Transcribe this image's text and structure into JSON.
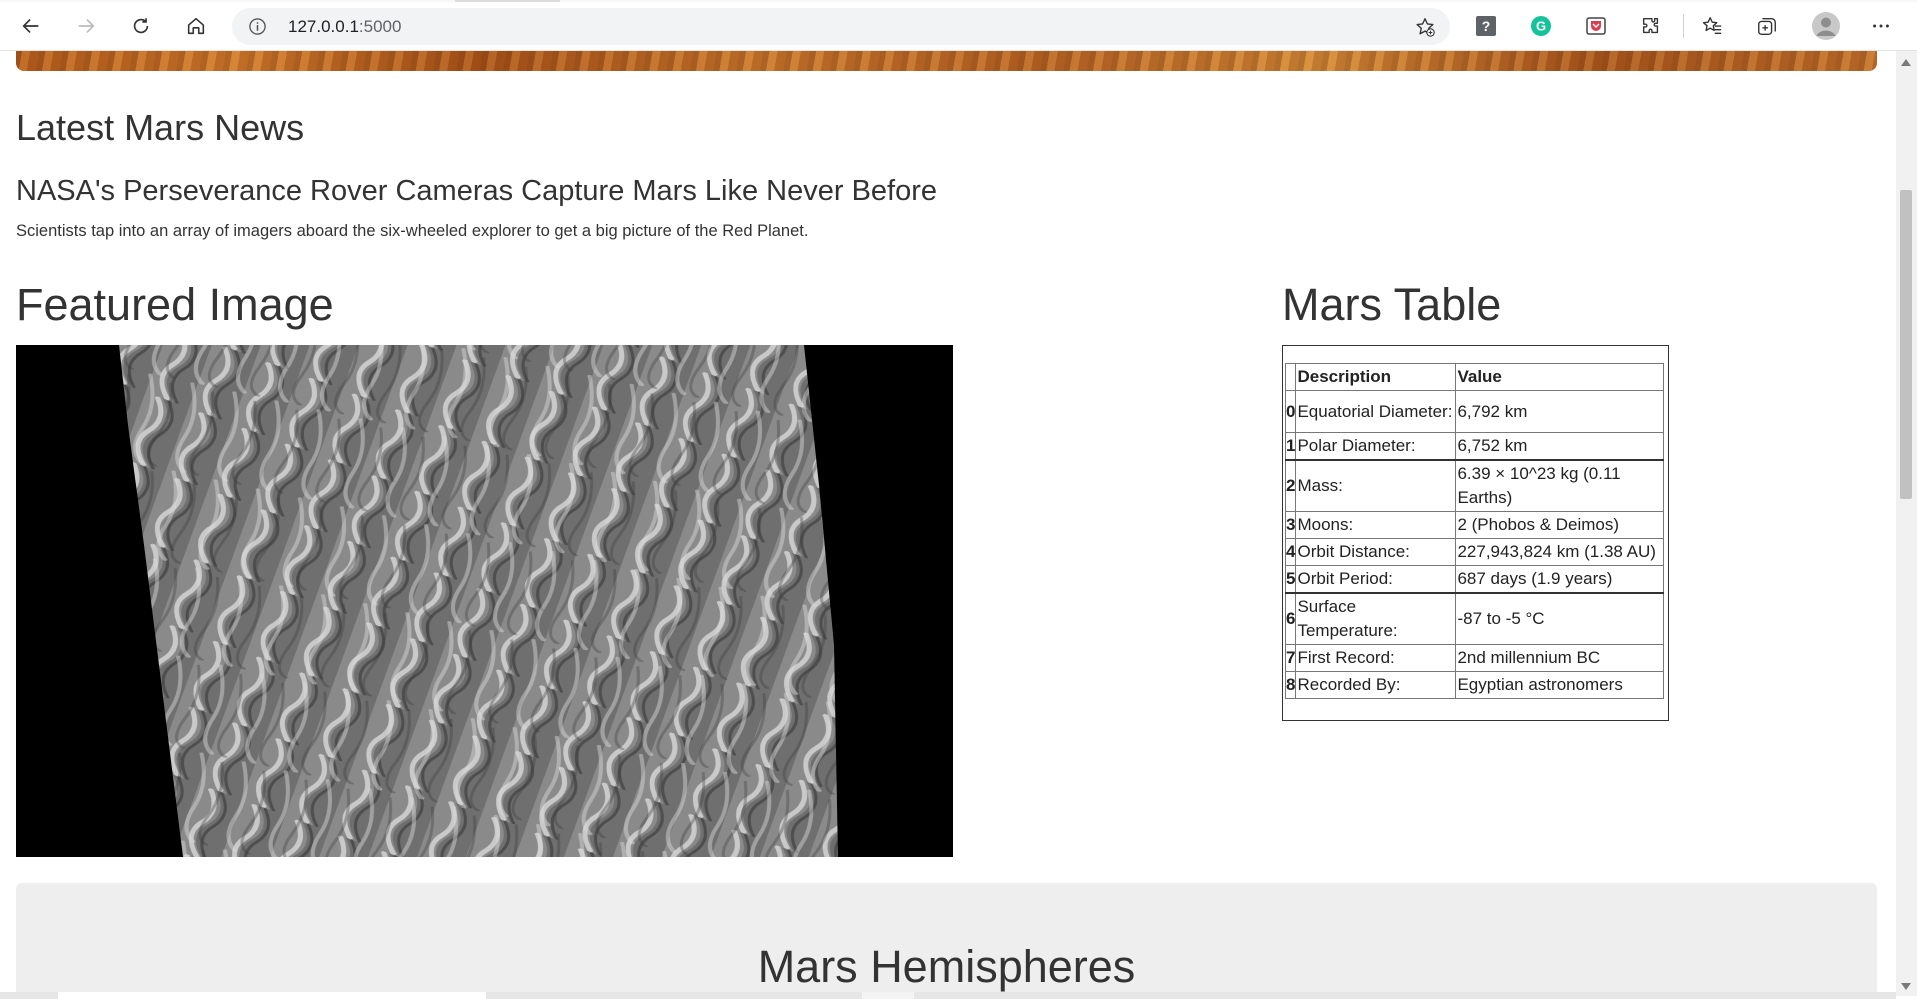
{
  "browser": {
    "url_host": "127.0.0.1",
    "url_port": ":5000",
    "icons": [
      "back-icon",
      "forward-icon",
      "refresh-icon",
      "home-icon",
      "site-info-icon",
      "add-favorite-icon",
      "help-extension-icon",
      "grammarly-icon",
      "pocket-icon",
      "extensions-icon",
      "favorites-icon",
      "collections-icon",
      "profile-icon",
      "more-icon"
    ]
  },
  "news": {
    "heading": "Latest Mars News",
    "title": "NASA's Perseverance Rover Cameras Capture Mars Like Never Before",
    "paragraph": "Scientists tap into an array of imagers aboard the six-wheeled explorer to get a big picture of the Red Planet."
  },
  "featured": {
    "heading": "Featured Image"
  },
  "mars_table": {
    "heading": "Mars Table",
    "columns": [
      "Description",
      "Value"
    ],
    "rows": [
      {
        "idx": "0",
        "desc": "Equatorial Diameter:",
        "value": "6,792 km"
      },
      {
        "idx": "1",
        "desc": "Polar Diameter:",
        "value": "6,752 km"
      },
      {
        "idx": "2",
        "desc": "Mass:",
        "value": "6.39 × 10^23 kg (0.11 Earths)"
      },
      {
        "idx": "3",
        "desc": "Moons:",
        "value": "2 (Phobos & Deimos)"
      },
      {
        "idx": "4",
        "desc": "Orbit Distance:",
        "value": "227,943,824 km (1.38 AU)"
      },
      {
        "idx": "5",
        "desc": "Orbit Period:",
        "value": "687 days (1.9 years)"
      },
      {
        "idx": "6",
        "desc": "Surface Temperature:",
        "value": "-87 to -5 °C"
      },
      {
        "idx": "7",
        "desc": "First Record:",
        "value": "2nd millennium BC"
      },
      {
        "idx": "8",
        "desc": "Recorded By:",
        "value": "Egyptian astronomers"
      }
    ]
  },
  "hemispheres": {
    "heading": "Mars Hemispheres"
  },
  "colors": {
    "panel_bg": "#eeeeee",
    "text": "#333333",
    "banner": "#c2712b"
  }
}
